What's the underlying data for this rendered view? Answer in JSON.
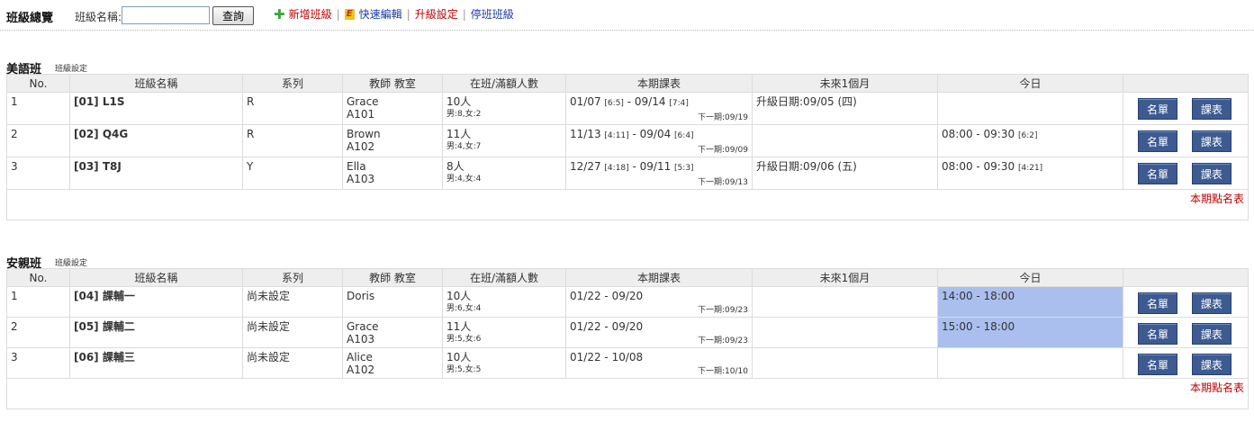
{
  "header": {
    "title": "班級總覽",
    "search_label": "班級名稱:",
    "search_value": "",
    "query_button": "查詢",
    "toolbar": {
      "new_class": "新增班級",
      "quick_edit": "快速編輯",
      "upgrade_settings": "升級設定",
      "stop_class": "停班班級",
      "separator": "|"
    }
  },
  "columns": [
    "No.",
    "班級名稱",
    "系列",
    "教師 教室",
    "在班/滿額人數",
    "本期課表",
    "未來1個月",
    "今日",
    ""
  ],
  "button_roster": "名單",
  "button_schedule": "課表",
  "colors": {
    "link_red": "#c00000",
    "link_blue": "#1a3aa0",
    "button_bg": "#3d5a91",
    "today_highlight": "#aabfee"
  },
  "sections": [
    {
      "title": "美語班",
      "settings": "班級設定",
      "footer_link": "本期點名表",
      "rows": [
        {
          "no": "1",
          "name": "[01] L1S",
          "series": "R",
          "teacher": "Grace",
          "room": "A101",
          "count": "10人",
          "gender": "男:8,女:2",
          "schedule": "01/07",
          "sch_a": "[6:5]",
          "sch_end": "09/14",
          "sch_b": "[7:4]",
          "next": "下一期:09/19",
          "future": "升級日期:09/05 (四)",
          "today": "",
          "today_tag": "",
          "highlight": false
        },
        {
          "no": "2",
          "name": "[02] Q4G",
          "series": "R",
          "teacher": "Brown",
          "room": "A102",
          "count": "11人",
          "gender": "男:4,女:7",
          "schedule": "11/13",
          "sch_a": "[4:11]",
          "sch_end": "09/04",
          "sch_b": "[6:4]",
          "next": "下一期:09/09",
          "future": "",
          "today": "08:00 - 09:30",
          "today_tag": "[6:2]",
          "highlight": false
        },
        {
          "no": "3",
          "name": "[03] T8J",
          "series": "Y",
          "teacher": "Ella",
          "room": "A103",
          "count": "8人",
          "gender": "男:4,女:4",
          "schedule": "12/27",
          "sch_a": "[4:18]",
          "sch_end": "09/11",
          "sch_b": "[5:3]",
          "next": "下一期:09/13",
          "future": "升級日期:09/06 (五)",
          "today": "08:00 - 09:30",
          "today_tag": "[4:21]",
          "highlight": false
        }
      ]
    },
    {
      "title": "安親班",
      "settings": "班級設定",
      "footer_link": "本期點名表",
      "rows": [
        {
          "no": "1",
          "name": "[04] 課輔一",
          "series": "尚未設定",
          "teacher": "Doris",
          "room": "",
          "count": "10人",
          "gender": "男:6,女:4",
          "schedule": "01/22",
          "sch_a": "",
          "sch_end": "09/20",
          "sch_b": "",
          "next": "下一期:09/23",
          "future": "",
          "today": "14:00 - 18:00",
          "today_tag": "",
          "highlight": true
        },
        {
          "no": "2",
          "name": "[05] 課輔二",
          "series": "尚未設定",
          "teacher": "Grace",
          "room": "A103",
          "count": "11人",
          "gender": "男:5,女:6",
          "schedule": "01/22",
          "sch_a": "",
          "sch_end": "09/20",
          "sch_b": "",
          "next": "下一期:09/23",
          "future": "",
          "today": "15:00 - 18:00",
          "today_tag": "",
          "highlight": true
        },
        {
          "no": "3",
          "name": "[06] 課輔三",
          "series": "尚未設定",
          "teacher": "Alice",
          "room": "A102",
          "count": "10人",
          "gender": "男:5,女:5",
          "schedule": "01/22",
          "sch_a": "",
          "sch_end": "10/08",
          "sch_b": "",
          "next": "下一期:10/10",
          "future": "",
          "today": "",
          "today_tag": "",
          "highlight": false
        }
      ]
    }
  ]
}
